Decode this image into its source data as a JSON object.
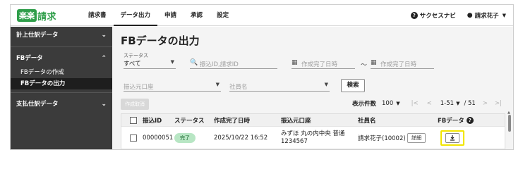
{
  "app": {
    "logo_badge": "楽楽",
    "logo_rest": "請求",
    "nav": [
      "請求書",
      "データ出力",
      "申請",
      "承認",
      "設定"
    ],
    "help_label": "サクセスナビ",
    "user_name": "請求花子"
  },
  "sidebar": {
    "groups": [
      {
        "label": "計上仕訳データ",
        "expanded": false
      },
      {
        "label": "FBデータ",
        "expanded": true,
        "items": [
          "FBデータの作成",
          "FBデータの出力"
        ]
      },
      {
        "label": "支払仕訳データ",
        "expanded": false
      }
    ]
  },
  "main": {
    "title": "FBデータの出力",
    "status_label": "ステータス",
    "status_value": "すべて",
    "search_placeholder": "振込ID,請求ID",
    "date_from_placeholder": "作成完了日時",
    "date_to_placeholder": "作成完了日時",
    "range_sep": "〜",
    "account_placeholder": "振込元口座",
    "employee_placeholder": "社員名",
    "search_button": "検索",
    "cancel_button": "作成取消",
    "per_page_label": "表示件数",
    "per_page_value": "100",
    "page_range": "1-51",
    "page_total": "/ 51"
  },
  "table": {
    "columns": [
      "振込ID",
      "ステータス",
      "作成完了日時",
      "振込元口座",
      "社員名",
      "FBデータ"
    ],
    "rows": [
      {
        "id": "00000051",
        "status": "完了",
        "completed_at": "2025/10/22 16:52",
        "account_line1": "みずほ 丸の内中央 普通",
        "account_line2": "1234567",
        "employee": "請求花子(10002)",
        "detail": "詳細"
      }
    ]
  },
  "colors": {
    "brand": "#2f9e4a",
    "sidebar_bg": "#3b3b3b",
    "highlight": "#f2e600",
    "status_done": "#b8e6c4"
  }
}
